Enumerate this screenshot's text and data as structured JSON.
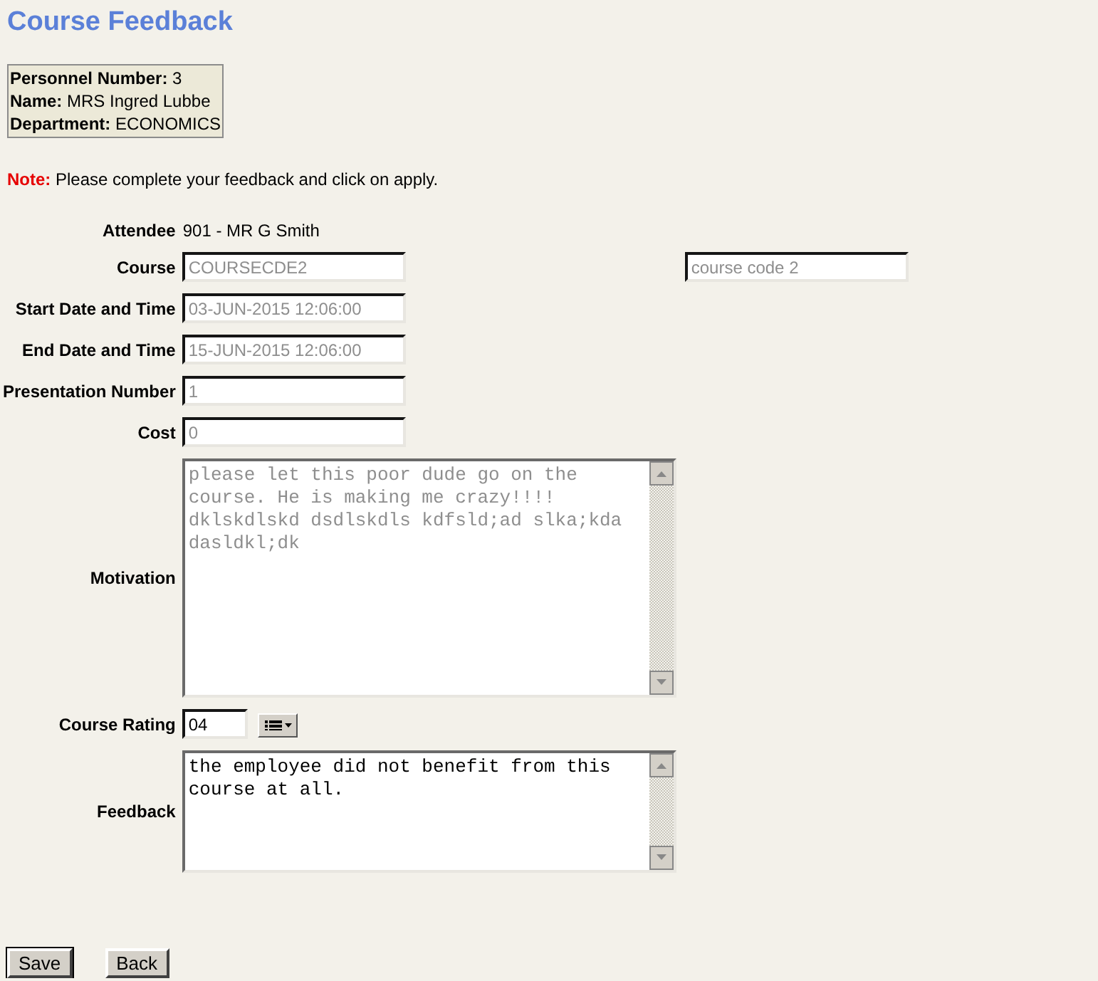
{
  "title": "Course Feedback",
  "personnel": [
    {
      "label": "Personnel Number:",
      "value": "3"
    },
    {
      "label": "Name:",
      "value": "MRS Ingred Lubbe"
    },
    {
      "label": "Department:",
      "value": "ECONOMICS"
    }
  ],
  "note": {
    "label": "Note:",
    "text": "Please complete your feedback and click on apply."
  },
  "fields": [
    {
      "kind": "static",
      "label": "Attendee",
      "value": "901 - MR G Smith"
    },
    {
      "kind": "text",
      "label": "Course",
      "value": "COURSECDE2",
      "disabled": true,
      "extra": {
        "value": "course code 2",
        "disabled": true
      }
    },
    {
      "kind": "text",
      "label": "Start Date and Time",
      "value": "03-JUN-2015 12:06:00",
      "disabled": true
    },
    {
      "kind": "text",
      "label": "End Date and Time",
      "value": "15-JUN-2015 12:06:00",
      "disabled": true
    },
    {
      "kind": "text",
      "label": "Presentation Number",
      "value": "1",
      "disabled": true
    },
    {
      "kind": "text",
      "label": "Cost",
      "value": "0",
      "disabled": true
    },
    {
      "kind": "textarea",
      "label": "Motivation",
      "value": "please let this poor dude go on the course. He is making me crazy!!!! dklskdlskd dsdlskdls kdfsld;ad slka;kda dasldkl;dk",
      "disabled": true
    },
    {
      "kind": "rating",
      "label": "Course Rating",
      "value": "04",
      "disabled": false
    },
    {
      "kind": "textarea",
      "label": "Feedback",
      "value": "the employee did not benefit from this course at all.",
      "disabled": false
    }
  ],
  "buttons": [
    {
      "label": "Save",
      "default": true
    },
    {
      "label": "Back",
      "default": false
    }
  ]
}
